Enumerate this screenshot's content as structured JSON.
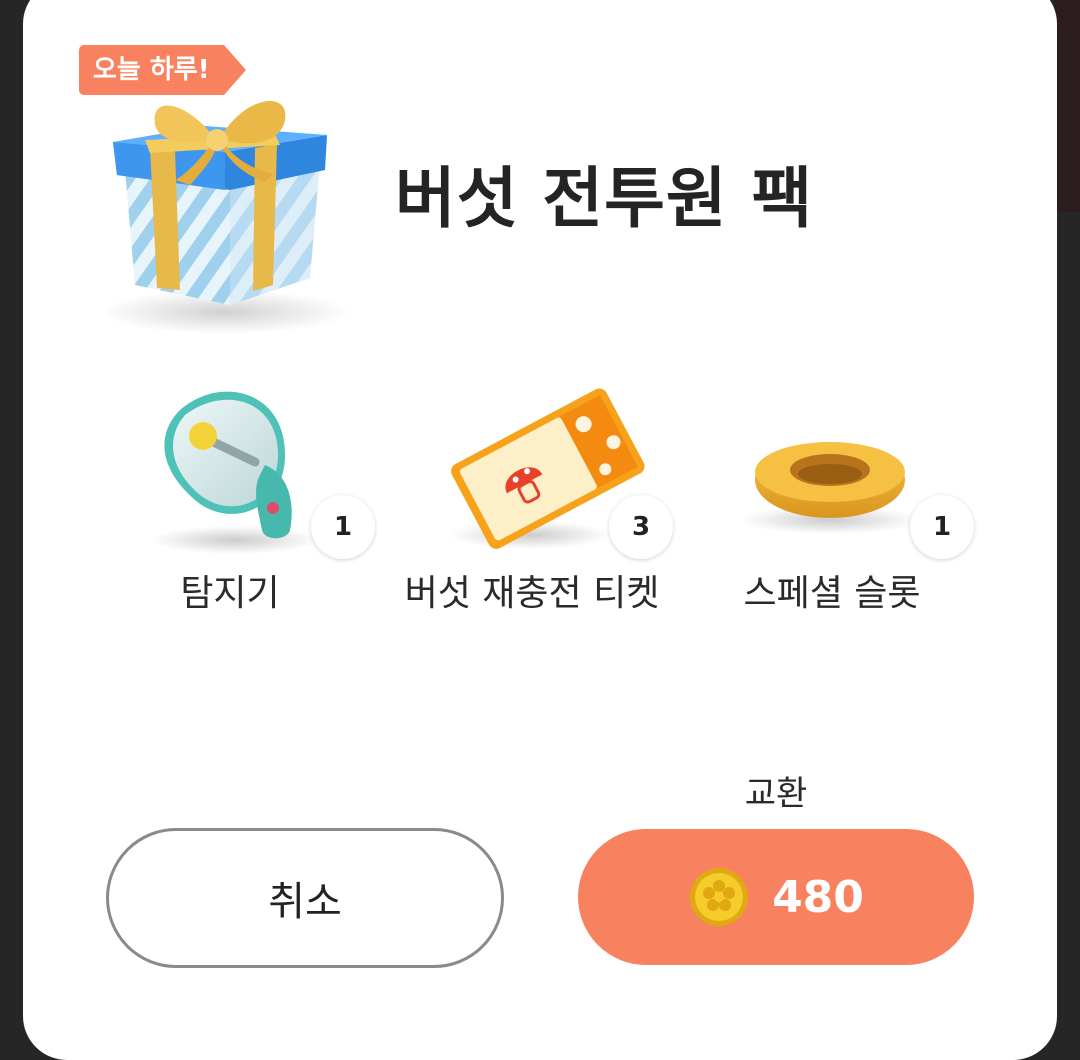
{
  "pack": {
    "badge": "오늘 하루!",
    "title": "버섯 전투원 팩",
    "icon": "gift-box-icon"
  },
  "items": [
    {
      "label": "탐지기",
      "count": "1",
      "icon": "detector-icon"
    },
    {
      "label": "버섯 재충전 티켓",
      "count": "3",
      "icon": "mushroom-ticket-icon"
    },
    {
      "label": "스페셜 슬롯",
      "count": "1",
      "icon": "special-slot-icon"
    }
  ],
  "actions": {
    "exchange_label": "교환",
    "cancel_label": "취소",
    "price": "480",
    "currency_icon": "coin-icon"
  },
  "colors": {
    "accent": "#f8825f",
    "background": "#262626",
    "dialog": "#ffffff"
  }
}
